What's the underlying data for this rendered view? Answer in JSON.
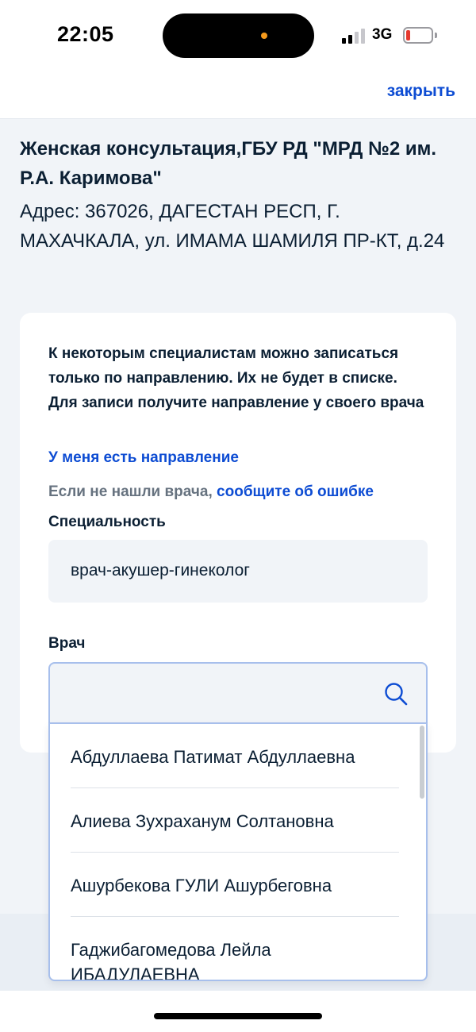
{
  "status_bar": {
    "time": "22:05",
    "network": "3G",
    "signal_bars_active": 2,
    "battery_level": "low",
    "icons": [
      "cellular-signal-icon",
      "battery-icon"
    ]
  },
  "header": {
    "close_label": "закрыть"
  },
  "organization": {
    "name": "Женская консультация,ГБУ РД \"МРД №2 им. Р.А. Каримова\"",
    "address": "Адрес: 367026, ДАГЕСТАН РЕСП, Г. МАХАЧКАЛА, ул. ИМАМА ШАМИЛЯ ПР-КТ, д.24"
  },
  "card": {
    "notice": "К некоторым специалистам можно записаться только по направлению. Их не будет в списке. Для записи получите направление у своего врача",
    "referral_link": "У меня есть направление",
    "error_prefix": "Если не нашли врача,",
    "error_link": "сообщите об ошибке",
    "specialty_label": "Специальность",
    "specialty_value": "врач-акушер-гинеколог",
    "doctor_label": "Врач",
    "doctor_search_value": "",
    "search_icon": "search-icon"
  },
  "doctor_dropdown": {
    "options": [
      "Абдуллаева Патимат Абдуллаевна",
      "Алиева Зухраханум Солтановна",
      "Ашурбекова ГУЛИ Ашурбеговна",
      "Гаджибагомедова Лейла",
      "ИБАДУЛАЕВНА"
    ]
  },
  "colors": {
    "accent": "#0d4cd3",
    "text": "#0b1f33",
    "muted": "#66727f",
    "background": "#f1f4f8",
    "field_border": "#a7bfec"
  }
}
